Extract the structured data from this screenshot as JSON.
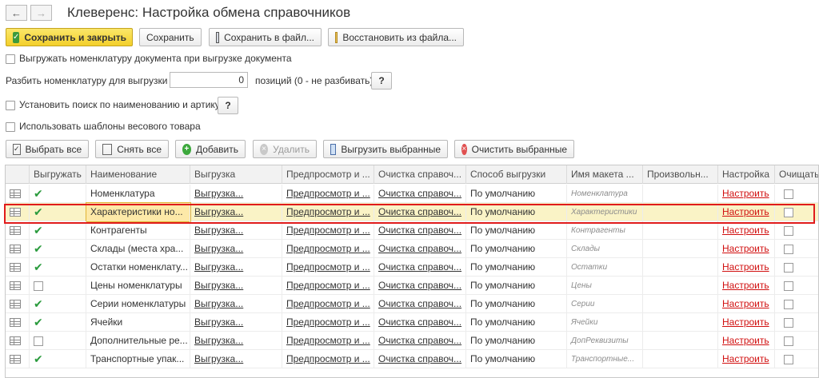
{
  "window": {
    "title": "Клеверенс: Настройка обмена справочников"
  },
  "toolbar": {
    "save_close": "Сохранить и закрыть",
    "save": "Сохранить",
    "save_file": "Сохранить в файл...",
    "restore_file": "Восстановить из файла..."
  },
  "options": {
    "export_doc_nomenclature": "Выгружать номенклатуру документа при выгрузке документа",
    "split_label": "Разбить номенклатуру для выгрузки по:",
    "split_value": "0",
    "split_suffix": "позиций (0 - не разбивать)",
    "search_label": "Установить поиск по наименованию и артикулу",
    "weight_templates": "Использовать шаблоны весового товара",
    "help": "?"
  },
  "actions": {
    "select_all": "Выбрать все",
    "deselect_all": "Снять все",
    "add": "Добавить",
    "delete": "Удалить",
    "export_selected": "Выгрузить выбранные",
    "clear_selected": "Очистить выбранные"
  },
  "table": {
    "headers": [
      "Выгружать",
      "Наименование",
      "Выгрузка",
      "Предпросмотр и ...",
      "Очистка справоч...",
      "Способ выгрузки",
      "Имя макета ...",
      "Произвольн...",
      "Настройка",
      "Очищать"
    ],
    "rows": [
      {
        "export": true,
        "name": "Номенклатура",
        "upload": "Выгрузка...",
        "preview": "Предпросмотр и ...",
        "clean": "Очистка справоч...",
        "method": "По умолчанию",
        "template": "Номенклатура",
        "custom": "",
        "settings": "Настроить"
      },
      {
        "export": true,
        "name": "Характеристики но...",
        "upload": "Выгрузка...",
        "preview": "Предпросмотр и ...",
        "clean": "Очистка справоч...",
        "method": "По умолчанию",
        "template": "Характеристики",
        "custom": "",
        "settings": "Настроить"
      },
      {
        "export": true,
        "name": "Контрагенты",
        "upload": "Выгрузка...",
        "preview": "Предпросмотр и ...",
        "clean": "Очистка справоч...",
        "method": "По умолчанию",
        "template": "Контрагенты",
        "custom": "",
        "settings": "Настроить"
      },
      {
        "export": true,
        "name": "Склады (места хра...",
        "upload": "Выгрузка...",
        "preview": "Предпросмотр и ...",
        "clean": "Очистка справоч...",
        "method": "По умолчанию",
        "template": "Склады",
        "custom": "",
        "settings": "Настроить"
      },
      {
        "export": true,
        "name": "Остатки номенклату...",
        "upload": "Выгрузка...",
        "preview": "Предпросмотр и ...",
        "clean": "Очистка справоч...",
        "method": "По умолчанию",
        "template": "Остатки",
        "custom": "",
        "settings": "Настроить"
      },
      {
        "export": false,
        "name": "Цены номенклатуры",
        "upload": "Выгрузка...",
        "preview": "Предпросмотр и ...",
        "clean": "Очистка справоч...",
        "method": "По умолчанию",
        "template": "Цены",
        "custom": "",
        "settings": "Настроить"
      },
      {
        "export": true,
        "name": "Серии номенклатуры",
        "upload": "Выгрузка...",
        "preview": "Предпросмотр и ...",
        "clean": "Очистка справоч...",
        "method": "По умолчанию",
        "template": "Серии",
        "custom": "",
        "settings": "Настроить"
      },
      {
        "export": true,
        "name": "Ячейки",
        "upload": "Выгрузка...",
        "preview": "Предпросмотр и ...",
        "clean": "Очистка справоч...",
        "method": "По умолчанию",
        "template": "Ячейки",
        "custom": "",
        "settings": "Настроить"
      },
      {
        "export": false,
        "name": "Дополнительные ре...",
        "upload": "Выгрузка...",
        "preview": "Предпросмотр и ...",
        "clean": "Очистка справоч...",
        "method": "По умолчанию",
        "template": "ДопРеквизиты",
        "custom": "",
        "settings": "Настроить"
      },
      {
        "export": true,
        "name": "Транспортные упак...",
        "upload": "Выгрузка...",
        "preview": "Предпросмотр и ...",
        "clean": "Очистка справоч...",
        "method": "По умолчанию",
        "template": "Транспортные...",
        "custom": "",
        "settings": "Настроить"
      }
    ]
  },
  "colors": {
    "accent_yellow": "#f3cf2a",
    "link_red": "#d10f0f",
    "check_green": "#2a9b3d",
    "highlight_red": "#e01b1b",
    "selected_row": "#faf3c6"
  },
  "icons": {
    "back": "arrow-left-icon",
    "forward": "arrow-right-icon",
    "row": "table-row-icon"
  }
}
